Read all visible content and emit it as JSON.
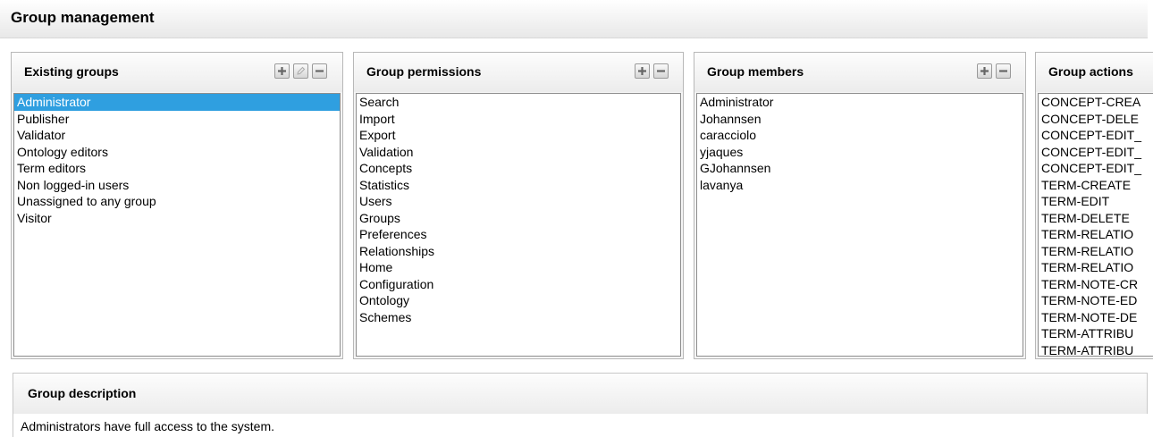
{
  "page": {
    "title": "Group management"
  },
  "panels": {
    "existing_groups": {
      "title": "Existing groups",
      "items": [
        "Administrator",
        "Publisher",
        "Validator",
        "Ontology editors",
        "Term editors",
        "Non logged-in users",
        "Unassigned to any group",
        "Visitor"
      ],
      "selected": "Administrator"
    },
    "group_permissions": {
      "title": "Group permissions",
      "items": [
        "Search",
        "Import",
        "Export",
        "Validation",
        "Concepts",
        "Statistics",
        "Users",
        "Groups",
        "Preferences",
        "Relationships",
        "Home",
        "Configuration",
        "Ontology",
        "Schemes"
      ]
    },
    "group_members": {
      "title": "Group members",
      "items": [
        "Administrator",
        "Johannsen",
        "caracciolo",
        "yjaques",
        "GJohannsen",
        "lavanya"
      ]
    },
    "group_actions": {
      "title": "Group actions",
      "items": [
        "CONCEPT-CREA",
        "CONCEPT-DELE",
        "CONCEPT-EDIT_",
        "CONCEPT-EDIT_",
        "CONCEPT-EDIT_",
        "TERM-CREATE",
        "TERM-EDIT",
        "TERM-DELETE",
        "TERM-RELATIO",
        "TERM-RELATIO",
        "TERM-RELATIO",
        "TERM-NOTE-CR",
        "TERM-NOTE-ED",
        "TERM-NOTE-DE",
        "TERM-ATTRIBU",
        "TERM-ATTRIBU"
      ]
    }
  },
  "description": {
    "title": "Group description",
    "text": "Administrators have full access to the system."
  },
  "icons": {
    "add": "plus-icon",
    "edit": "pencil-icon",
    "remove": "minus-icon"
  },
  "colors": {
    "selection": "#2f9fe0"
  }
}
